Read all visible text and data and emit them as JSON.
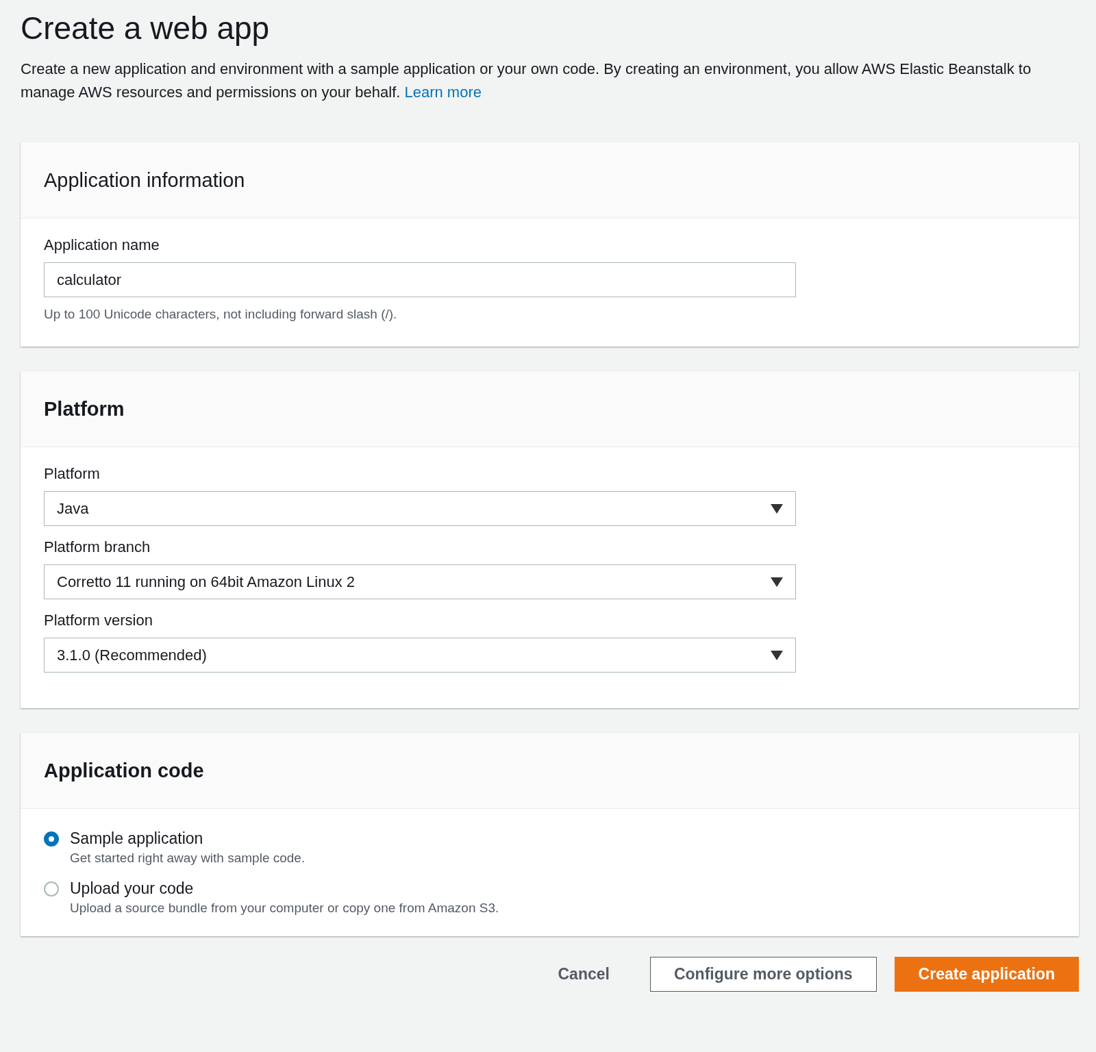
{
  "page": {
    "title": "Create a web app",
    "description": "Create a new application and environment with a sample application or your own code. By creating an environment, you allow AWS Elastic Beanstalk to manage AWS resources and permissions on your behalf.",
    "learn_more": "Learn more"
  },
  "application_information": {
    "title": "Application information",
    "fields": [
      {
        "kind": "text",
        "label": "Application name",
        "value": "calculator",
        "hint": "Up to 100 Unicode characters, not including forward slash (/)."
      }
    ]
  },
  "platform": {
    "title": "Platform",
    "fields": [
      {
        "kind": "select",
        "label": "Platform",
        "value": "Java"
      },
      {
        "kind": "select",
        "label": "Platform branch",
        "value": "Corretto 11 running on 64bit Amazon Linux 2"
      },
      {
        "kind": "select",
        "label": "Platform version",
        "value": "3.1.0 (Recommended)"
      }
    ]
  },
  "application_code": {
    "title": "Application code",
    "options": [
      {
        "label": "Sample application",
        "description": "Get started right away with sample code.",
        "selected": true
      },
      {
        "label": "Upload your code",
        "description": "Upload a source bundle from your computer or copy one from Amazon S3.",
        "selected": false
      }
    ]
  },
  "buttons": [
    {
      "kind": "link",
      "label": "Cancel"
    },
    {
      "kind": "secondary",
      "label": "Configure more options"
    },
    {
      "kind": "primary",
      "label": "Create application"
    }
  ]
}
